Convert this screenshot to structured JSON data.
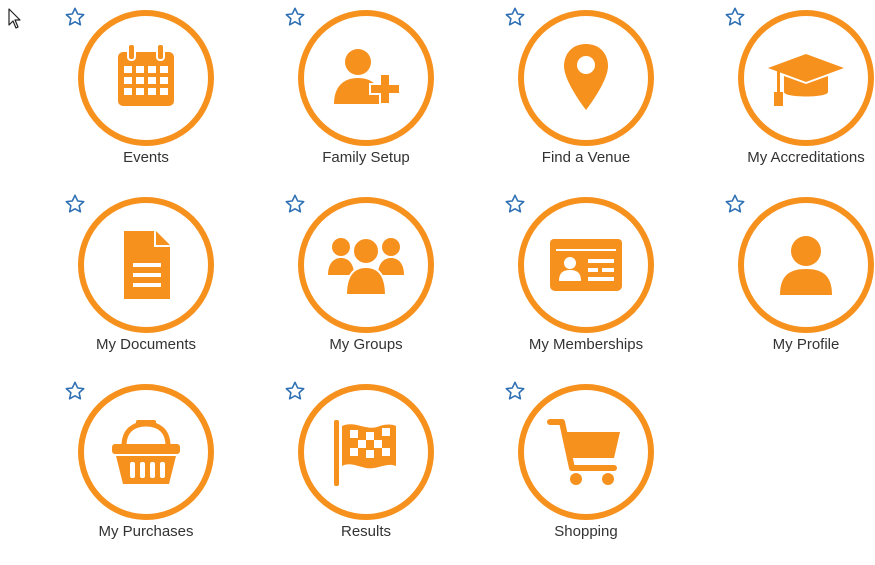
{
  "accent_color": "#f7911e",
  "star_color": "#2f6fb3",
  "tiles": [
    {
      "label": "Events",
      "icon": "calendar-icon"
    },
    {
      "label": "Family Setup",
      "icon": "add-user-icon"
    },
    {
      "label": "Find a Venue",
      "icon": "map-pin-icon"
    },
    {
      "label": "My Accreditations",
      "icon": "graduation-cap-icon"
    },
    {
      "label": "My Documents",
      "icon": "document-icon"
    },
    {
      "label": "My Groups",
      "icon": "group-icon"
    },
    {
      "label": "My Memberships",
      "icon": "id-card-icon"
    },
    {
      "label": "My Profile",
      "icon": "user-icon"
    },
    {
      "label": "My Purchases",
      "icon": "basket-icon"
    },
    {
      "label": "Results",
      "icon": "checkered-flag-icon"
    },
    {
      "label": "Shopping",
      "icon": "shopping-cart-icon"
    }
  ]
}
